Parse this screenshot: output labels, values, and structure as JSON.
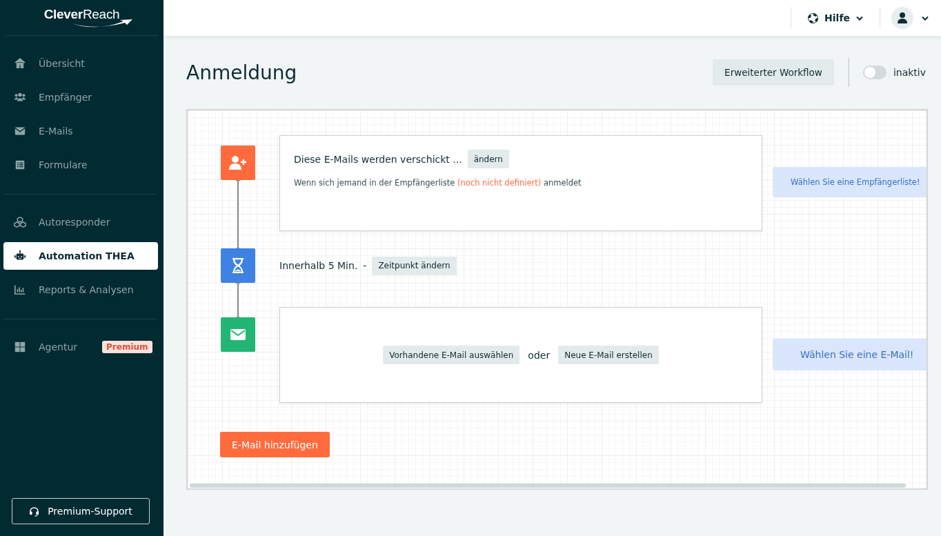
{
  "logo": "**Clever**Reach",
  "sidebar": {
    "groups": [
      [
        {
          "label": "Übersicht",
          "selected": false
        },
        {
          "label": "Empfänger",
          "selected": false
        },
        {
          "label": "E-Mails",
          "selected": false
        },
        {
          "label": "Formulare",
          "selected": false
        }
      ],
      [
        {
          "label": "Autoresponder",
          "selected": false
        },
        {
          "label": "Automation THEA",
          "selected": true
        },
        {
          "label": "Reports & Analysen",
          "selected": false
        }
      ],
      [
        {
          "label": "Agentur",
          "selected": false,
          "badge": "Premium"
        }
      ]
    ],
    "support_button": "Premium-Support"
  },
  "header": {
    "help": "Hilfe"
  },
  "page": {
    "title": "Anmeldung",
    "workflow_button": "Erweiterter Workflow",
    "toggle": {
      "on": false,
      "label": "inaktiv"
    }
  },
  "workflow": {
    "steps": [
      {
        "kind": "trigger",
        "title": "Diese E-Mails werden verschickt ...",
        "edit_button": "ändern",
        "description_before": "Wenn sich jemand in der Empfängerliste",
        "description_highlight": "(noch nicht definiert)",
        "description_after": "anmeldet",
        "hint": "Wählen Sie eine Empfängerliste!"
      },
      {
        "kind": "delay",
        "text": "Innerhalb 5 Min.",
        "separator": "-",
        "button": "Zeitpunkt ändern"
      },
      {
        "kind": "email",
        "choose_button": "Vorhandene E-Mail auswählen",
        "or": "oder",
        "create_button": "Neue E-Mail erstellen",
        "hint": "Wählen Sie eine E-Mail!"
      }
    ],
    "add_button": "E-Mail hinzufügen"
  }
}
